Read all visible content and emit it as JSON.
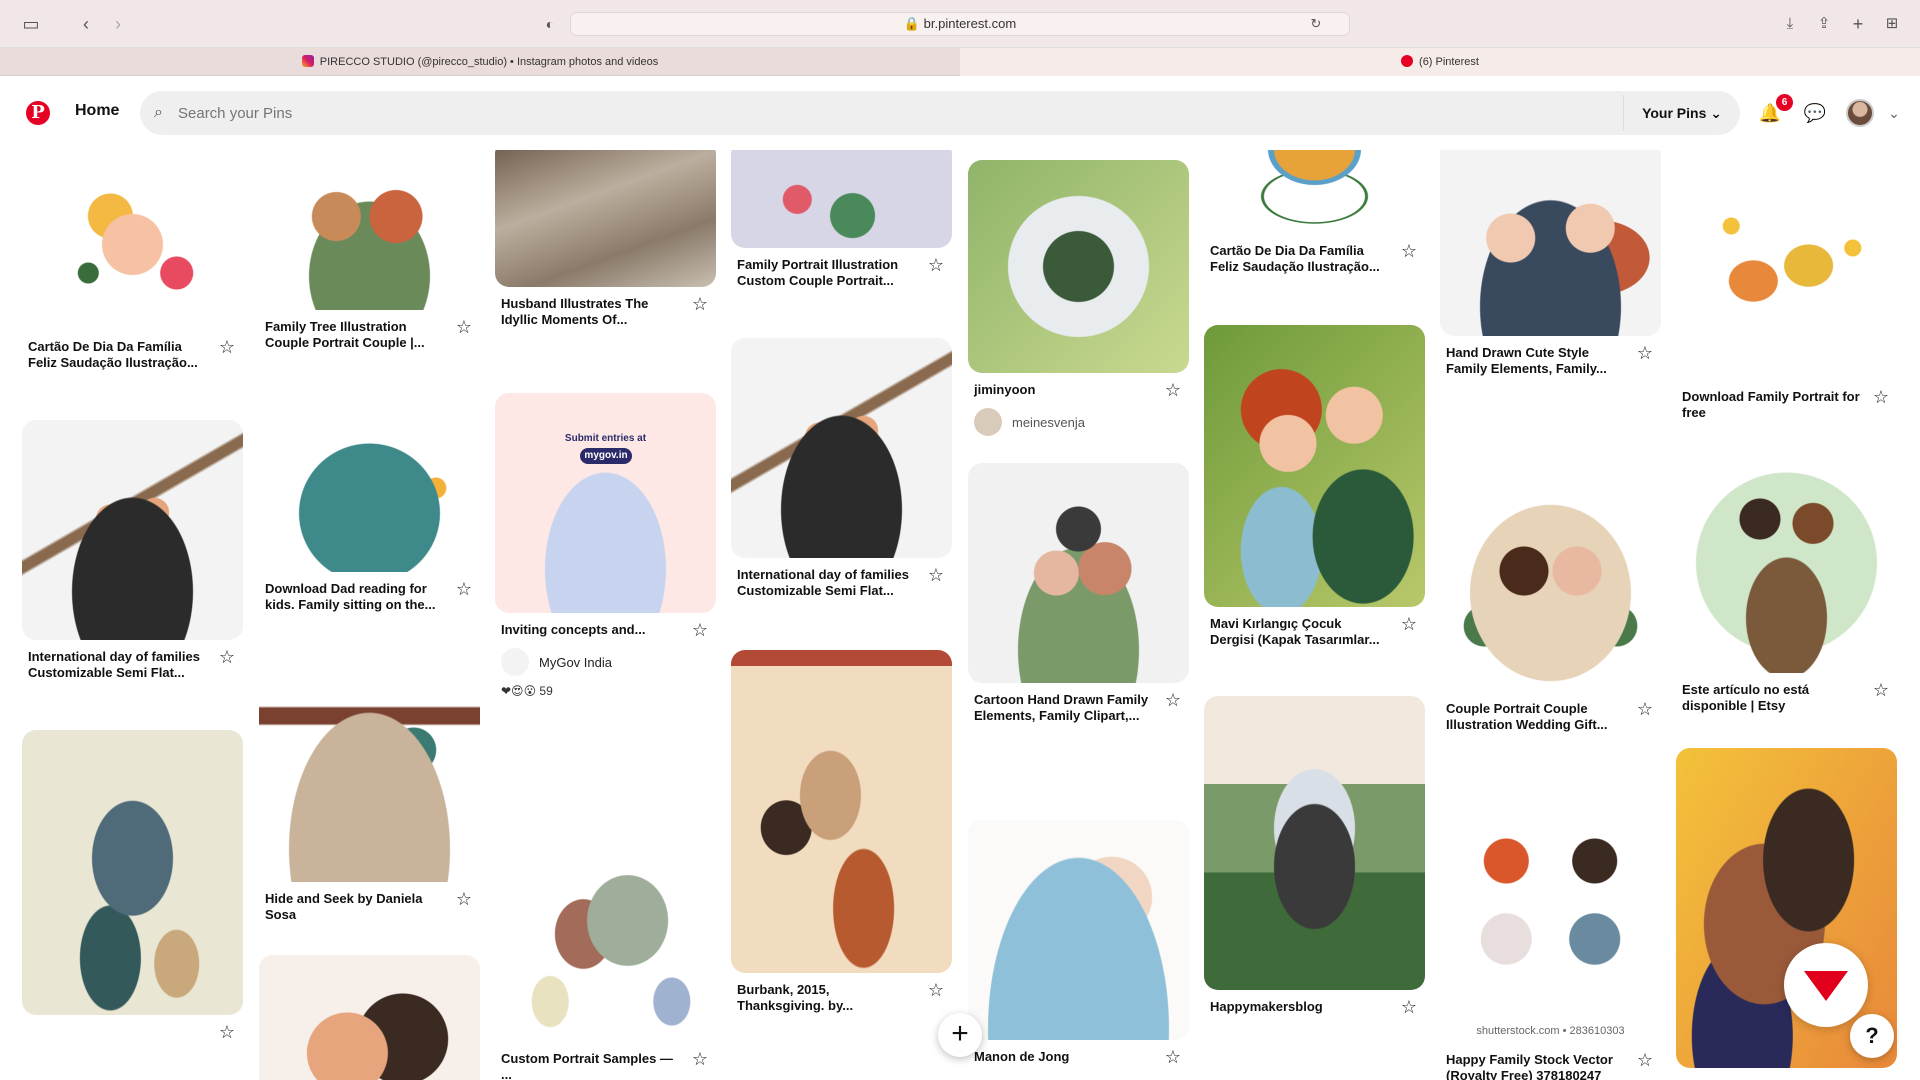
{
  "browser": {
    "url": "br.pinterest.com",
    "tabs": [
      {
        "label": "PIRECCO STUDIO (@pirecco_studio) • Instagram photos and videos"
      },
      {
        "label": "(6) Pinterest"
      }
    ]
  },
  "header": {
    "home_label": "Home",
    "search_placeholder": "Search your Pins",
    "your_pins_label": "Your Pins",
    "notification_count": "6"
  },
  "colors": {
    "brand": "#e60023",
    "search_bg": "#efefef"
  },
  "pins": [
    {
      "title": "Cartão De Dia Da Família Feliz Saudação Ilustração..."
    },
    {
      "title": "International day of families Customizable Semi Flat..."
    },
    {
      "title": ""
    },
    {
      "title": "Family Tree Illustration Couple Portrait Couple |..."
    },
    {
      "title": "Download Dad reading for kids. Family sitting on the..."
    },
    {
      "title": "Hide and Seek by Daniela Sosa"
    },
    {
      "title": "Husband Illustrates The Idyllic Moments Of..."
    },
    {
      "title": "Inviting concepts and...",
      "source": "MyGov India",
      "reactions": "59",
      "image_text": "Submit entries at",
      "image_badge": "mygov.in"
    },
    {
      "title": "Custom Portrait Samples — ..."
    },
    {
      "title": "Family Portrait Illustration Custom Couple Portrait..."
    },
    {
      "title": "International day of families Customizable Semi Flat..."
    },
    {
      "title": "Burbank, 2015, Thanksgiving. by..."
    },
    {
      "title": "jiminyoon",
      "source": "meinesvenja"
    },
    {
      "title": "Cartoon Hand Drawn Family Elements, Family Clipart,..."
    },
    {
      "title": "Manon de Jong"
    },
    {
      "title": "Cartão De Dia Da Família Feliz Saudação Ilustração..."
    },
    {
      "title": "Mavi Kırlangıç Çocuk Dergisi (Kapak Tasarımlar..."
    },
    {
      "title": "Happymakersblog"
    },
    {
      "title": "Hand Drawn Cute Style Family Elements, Family..."
    },
    {
      "title": "Couple Portrait Couple Illustration Wedding Gift..."
    },
    {
      "title": "Happy Family Stock Vector (Royalty Free) 378180247",
      "image_caption": "shutterstock.com • 283610303"
    },
    {
      "title": "Download Family Portrait for free"
    },
    {
      "title": "Este artículo no está disponible | Etsy"
    },
    {
      "title": ""
    }
  ]
}
